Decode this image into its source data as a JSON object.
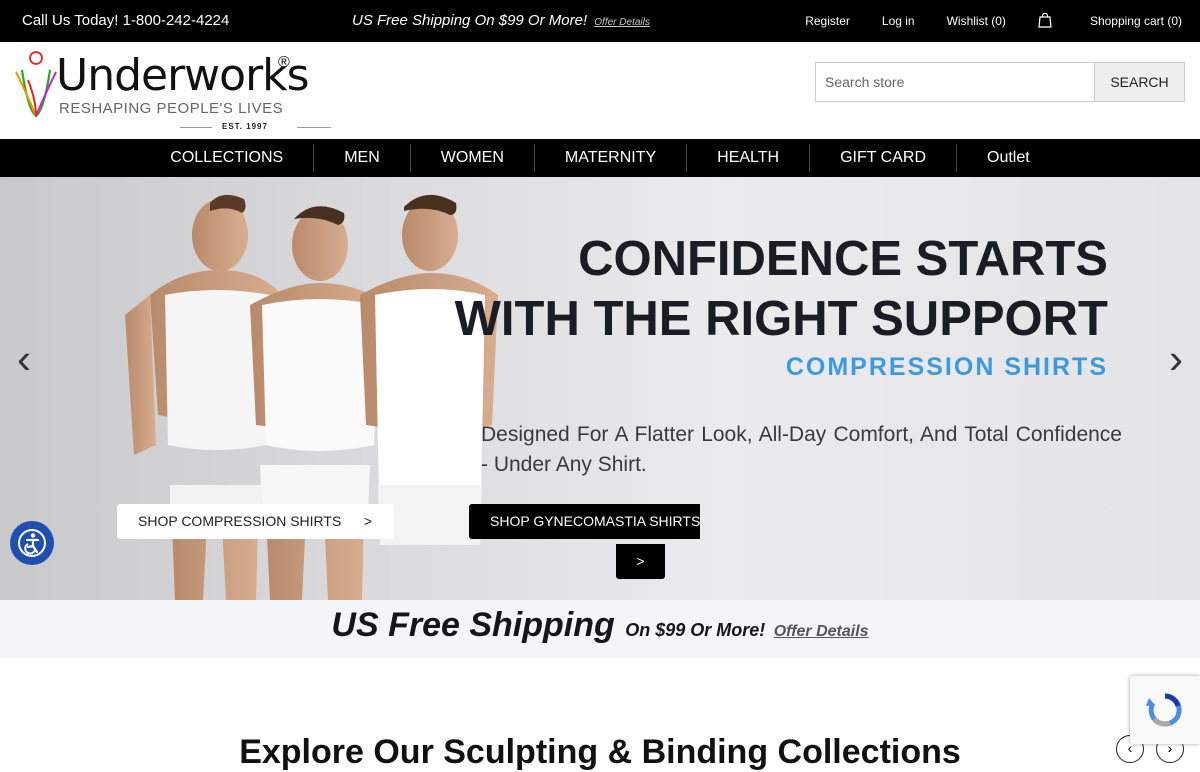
{
  "topbar": {
    "phone": "Call Us Today! 1-800-242-4224",
    "promo": "US Free Shipping On $99 Or More!",
    "offer_link": "Offer Details",
    "register": "Register",
    "login": "Log in",
    "wishlist": "Wishlist (0)",
    "cart": "Shopping cart (0)"
  },
  "logo": {
    "name": "Underworks",
    "registered": "®",
    "tagline": "RESHAPING PEOPLE'S LIVES",
    "est": "EST. 1997"
  },
  "search": {
    "placeholder": "Search store",
    "button": "SEARCH"
  },
  "nav": {
    "items": [
      "COLLECTIONS",
      "MEN",
      "WOMEN",
      "MATERNITY",
      "HEALTH",
      "GIFT CARD",
      "Outlet"
    ]
  },
  "hero": {
    "headline_line1": "CONFIDENCE STARTS",
    "headline_line2": "WITH THE RIGHT SUPPORT",
    "subheadline": "COMPRESSION SHIRTS",
    "description": "Designed For A Flatter Look, All-Day Comfort, And Total Confidence - Under Any Shirt.",
    "button1": "SHOP COMPRESSION SHIRTS",
    "button1_arrow": ">",
    "button2": "SHOP GYNECOMASTIA SHIRTS",
    "button2_arrow": ">",
    "prev": "‹",
    "next": "›"
  },
  "shipping_banner": {
    "big": "US Free Shipping",
    "small": "On $99 Or More!",
    "offer": "Offer Details"
  },
  "section": {
    "title": "Explore Our Sculpting & Binding Collections"
  },
  "colors": {
    "topbar": "#000000",
    "nav": "#000000",
    "accent_blue": "#3c9be0",
    "accessibility": "#1f4fb0"
  }
}
